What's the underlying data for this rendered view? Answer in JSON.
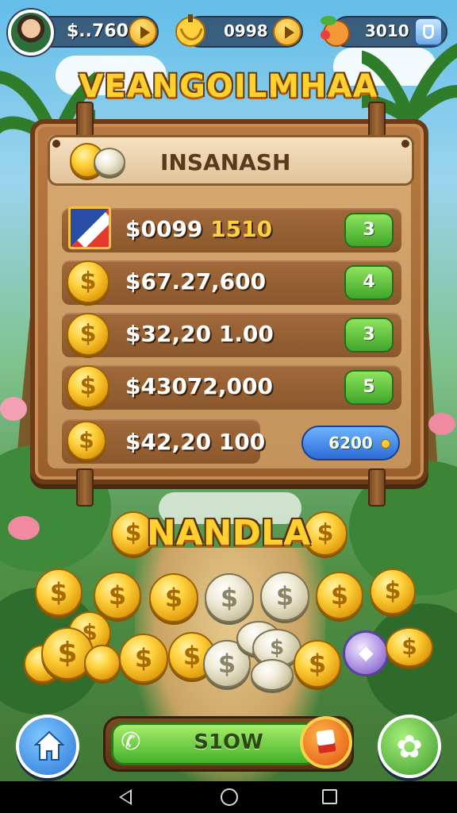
{
  "hud": {
    "money": "$..760",
    "resource": "0998",
    "fruit": "3010"
  },
  "title": "VEANGOILMHAA",
  "board": {
    "header": "INSANASH",
    "rows": [
      {
        "amount": "$0099 ",
        "amount_highlight": "1510",
        "badge": "3"
      },
      {
        "amount": "$67.27,600",
        "amount_highlight": "",
        "badge": "4"
      },
      {
        "amount": "$32,20 1.00",
        "amount_highlight": "",
        "badge": "3"
      },
      {
        "amount": "$43072,000",
        "amount_highlight": "",
        "badge": "5"
      },
      {
        "amount": "$42,20 100",
        "amount_highlight": "",
        "badge": "6200"
      }
    ]
  },
  "jackpot": "NANDLA",
  "controls": {
    "spin_label": "S1OW"
  },
  "colors": {
    "wood": "#9a5e2d",
    "gold": "#ffd12e",
    "green_button": "#3fa62a",
    "blue_button": "#2b6bd8"
  },
  "icons": [
    "avatar",
    "play-icon",
    "banana-icon",
    "fruit-icon",
    "shield-icon",
    "home-icon",
    "settings-icon",
    "phone-icon",
    "shop-icon"
  ]
}
